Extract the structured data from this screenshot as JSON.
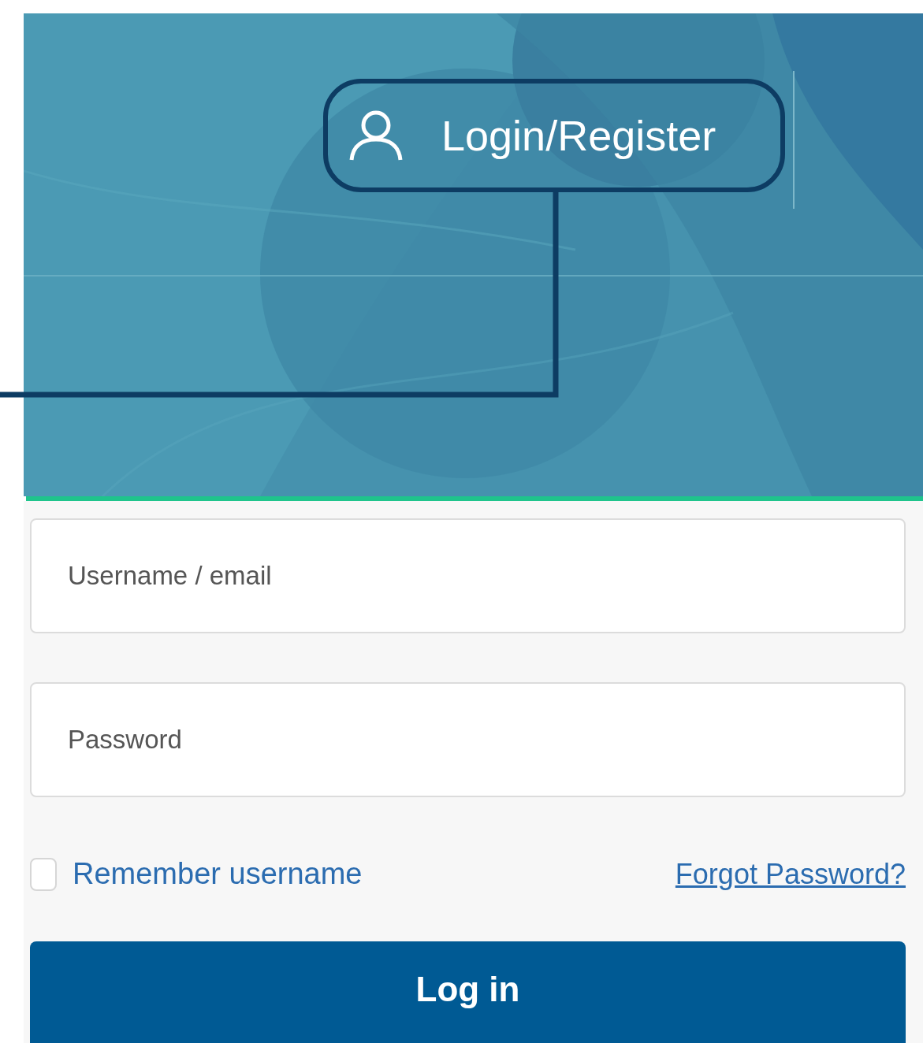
{
  "header": {
    "callout": {
      "label": "Login/Register"
    }
  },
  "form": {
    "username": {
      "placeholder": "Username / email"
    },
    "password": {
      "placeholder": "Password"
    },
    "remember": {
      "label": "Remember username",
      "checked": false
    },
    "forgot_link": "Forgot Password?",
    "submit": "Log in"
  }
}
